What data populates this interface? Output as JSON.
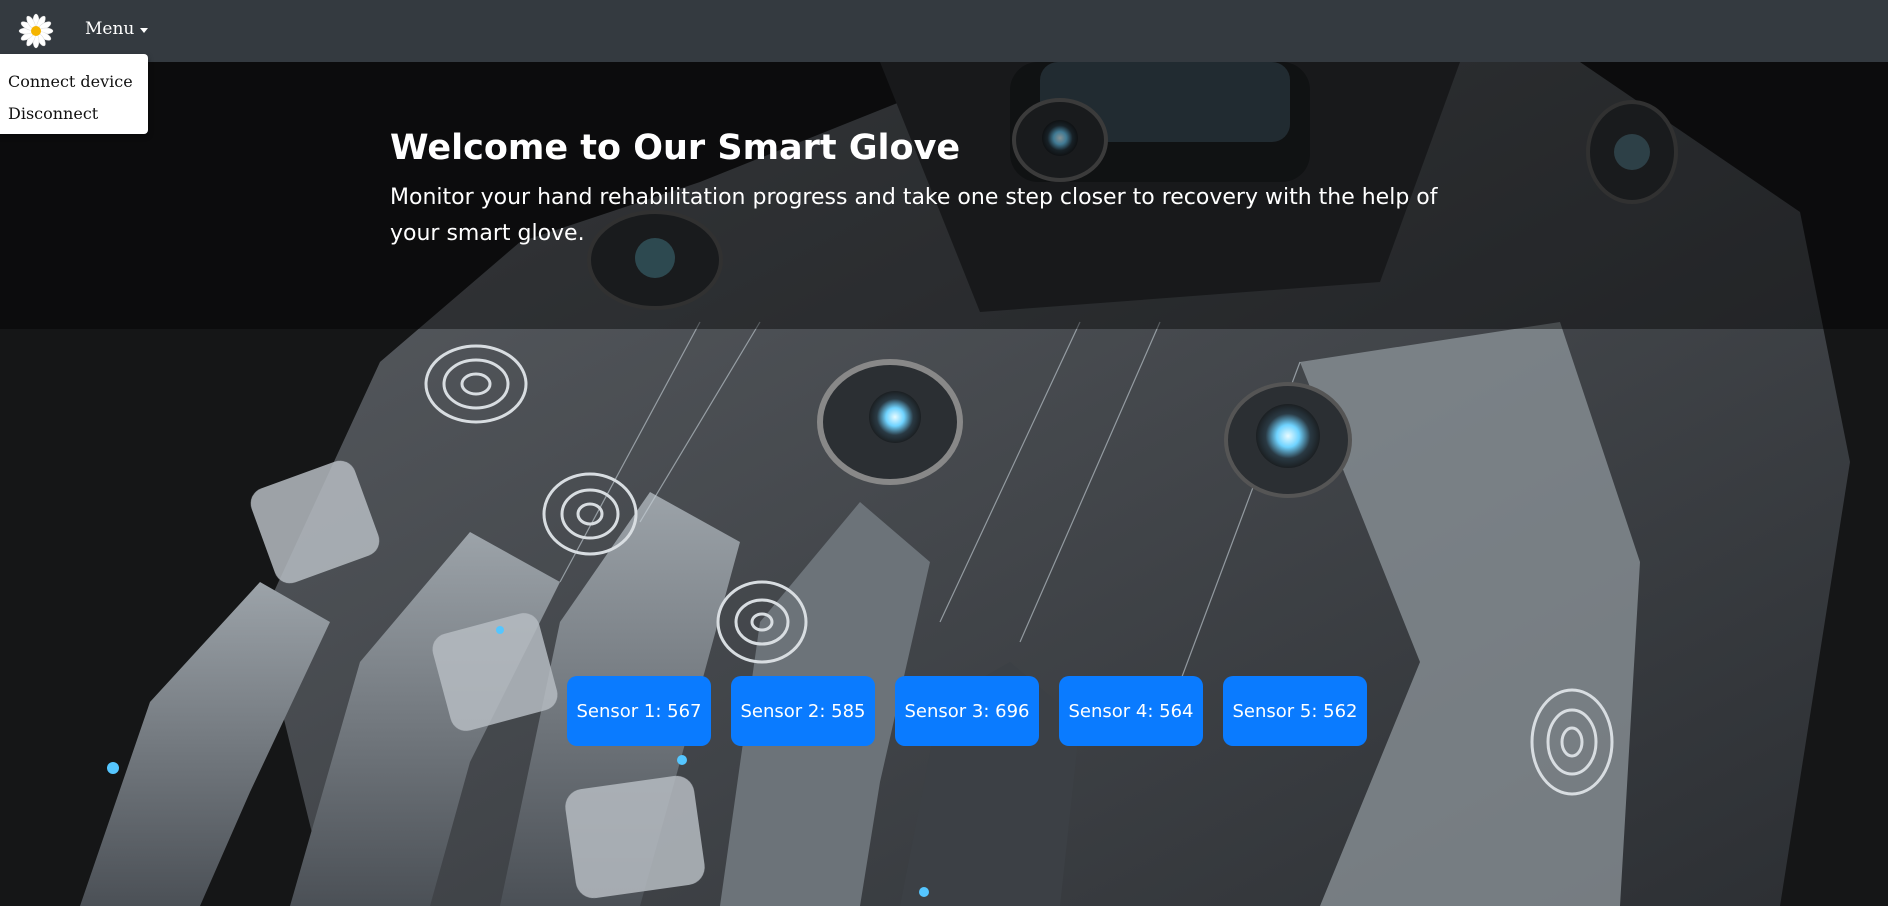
{
  "navbar": {
    "logo_icon": "daisy-icon",
    "menu_label": "Menu",
    "background": "#343a40"
  },
  "dropdown": {
    "items": [
      {
        "label": "Connect device"
      },
      {
        "label": "Disconnect"
      }
    ]
  },
  "hero": {
    "title": "Welcome to Our Smart Glove",
    "subtitle": "Monitor your hand rehabilitation progress and take one step closer to recovery with the help of your smart glove."
  },
  "sensors": [
    {
      "label": "Sensor 1: 567"
    },
    {
      "label": "Sensor 2: 585"
    },
    {
      "label": "Sensor 3: 696"
    },
    {
      "label": "Sensor 4: 564"
    },
    {
      "label": "Sensor 5: 562"
    }
  ],
  "colors": {
    "sensor_button": "#0a7bff",
    "text": "#ffffff"
  }
}
